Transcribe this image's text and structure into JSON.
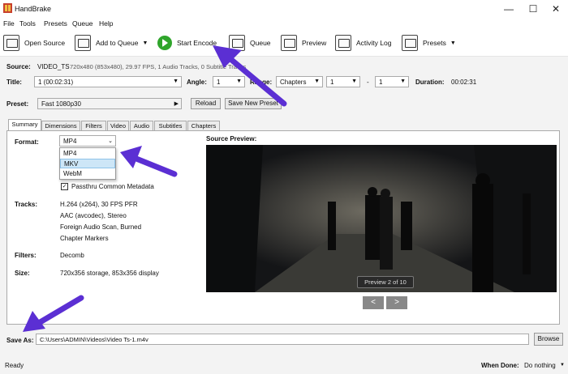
{
  "window": {
    "title": "HandBrake",
    "minimize": "—",
    "maximize": "☐",
    "close": "✕"
  },
  "menu": [
    "File",
    "Tools",
    "Presets",
    "Queue",
    "Help"
  ],
  "toolbar": {
    "open_source": "Open Source",
    "add_to_queue": "Add to Queue",
    "start_encode": "Start Encode",
    "queue": "Queue",
    "preview": "Preview",
    "activity_log": "Activity Log",
    "presets": "Presets"
  },
  "source": {
    "label": "Source:",
    "name": "VIDEO_TS",
    "info": "720x480 (853x480), 29.97 FPS, 1 Audio Tracks, 0 Subtitle Tracks"
  },
  "title_row": {
    "label": "Title:",
    "value": "1 (00:02:31)",
    "angle_label": "Angle:",
    "angle_value": "1",
    "range_label": "Range:",
    "range_value": "Chapters",
    "start_value": "1",
    "dash": "-",
    "end_value": "1",
    "duration_label": "Duration:",
    "duration_value": "00:02:31"
  },
  "preset_row": {
    "label": "Preset:",
    "value": "Fast 1080p30",
    "reload": "Reload",
    "save_new": "Save New Preset"
  },
  "tabs": [
    "Summary",
    "Dimensions",
    "Filters",
    "Video",
    "Audio",
    "Subtitles",
    "Chapters"
  ],
  "summary": {
    "format_label": "Format:",
    "format_value": "MP4",
    "format_options": [
      "MP4",
      "MKV",
      "WebM"
    ],
    "passthru_label": "Passthru Common Metadata",
    "tracks_label": "Tracks:",
    "tracks": [
      "H.264 (x264), 30 FPS PFR",
      "AAC (avcodec), Stereo",
      "Foreign Audio Scan, Burned",
      "Chapter Markers"
    ],
    "filters_label": "Filters:",
    "filters_value": "Decomb",
    "size_label": "Size:",
    "size_value": "720x356 storage, 853x356 display",
    "preview_label": "Source Preview:",
    "preview_badge": "Preview 2 of 10",
    "prev": "<",
    "next": ">"
  },
  "save_as": {
    "label": "Save As:",
    "value": "C:\\Users\\ADMIN\\Videos\\Video Ts-1.m4v",
    "browse": "Browse"
  },
  "status": {
    "left": "Ready",
    "when_done_label": "When Done:",
    "when_done_value": "Do nothing"
  },
  "colors": {
    "accent_arrow": "#5b2fd3",
    "play": "#2fa52b",
    "selection": "#cde6f7"
  }
}
